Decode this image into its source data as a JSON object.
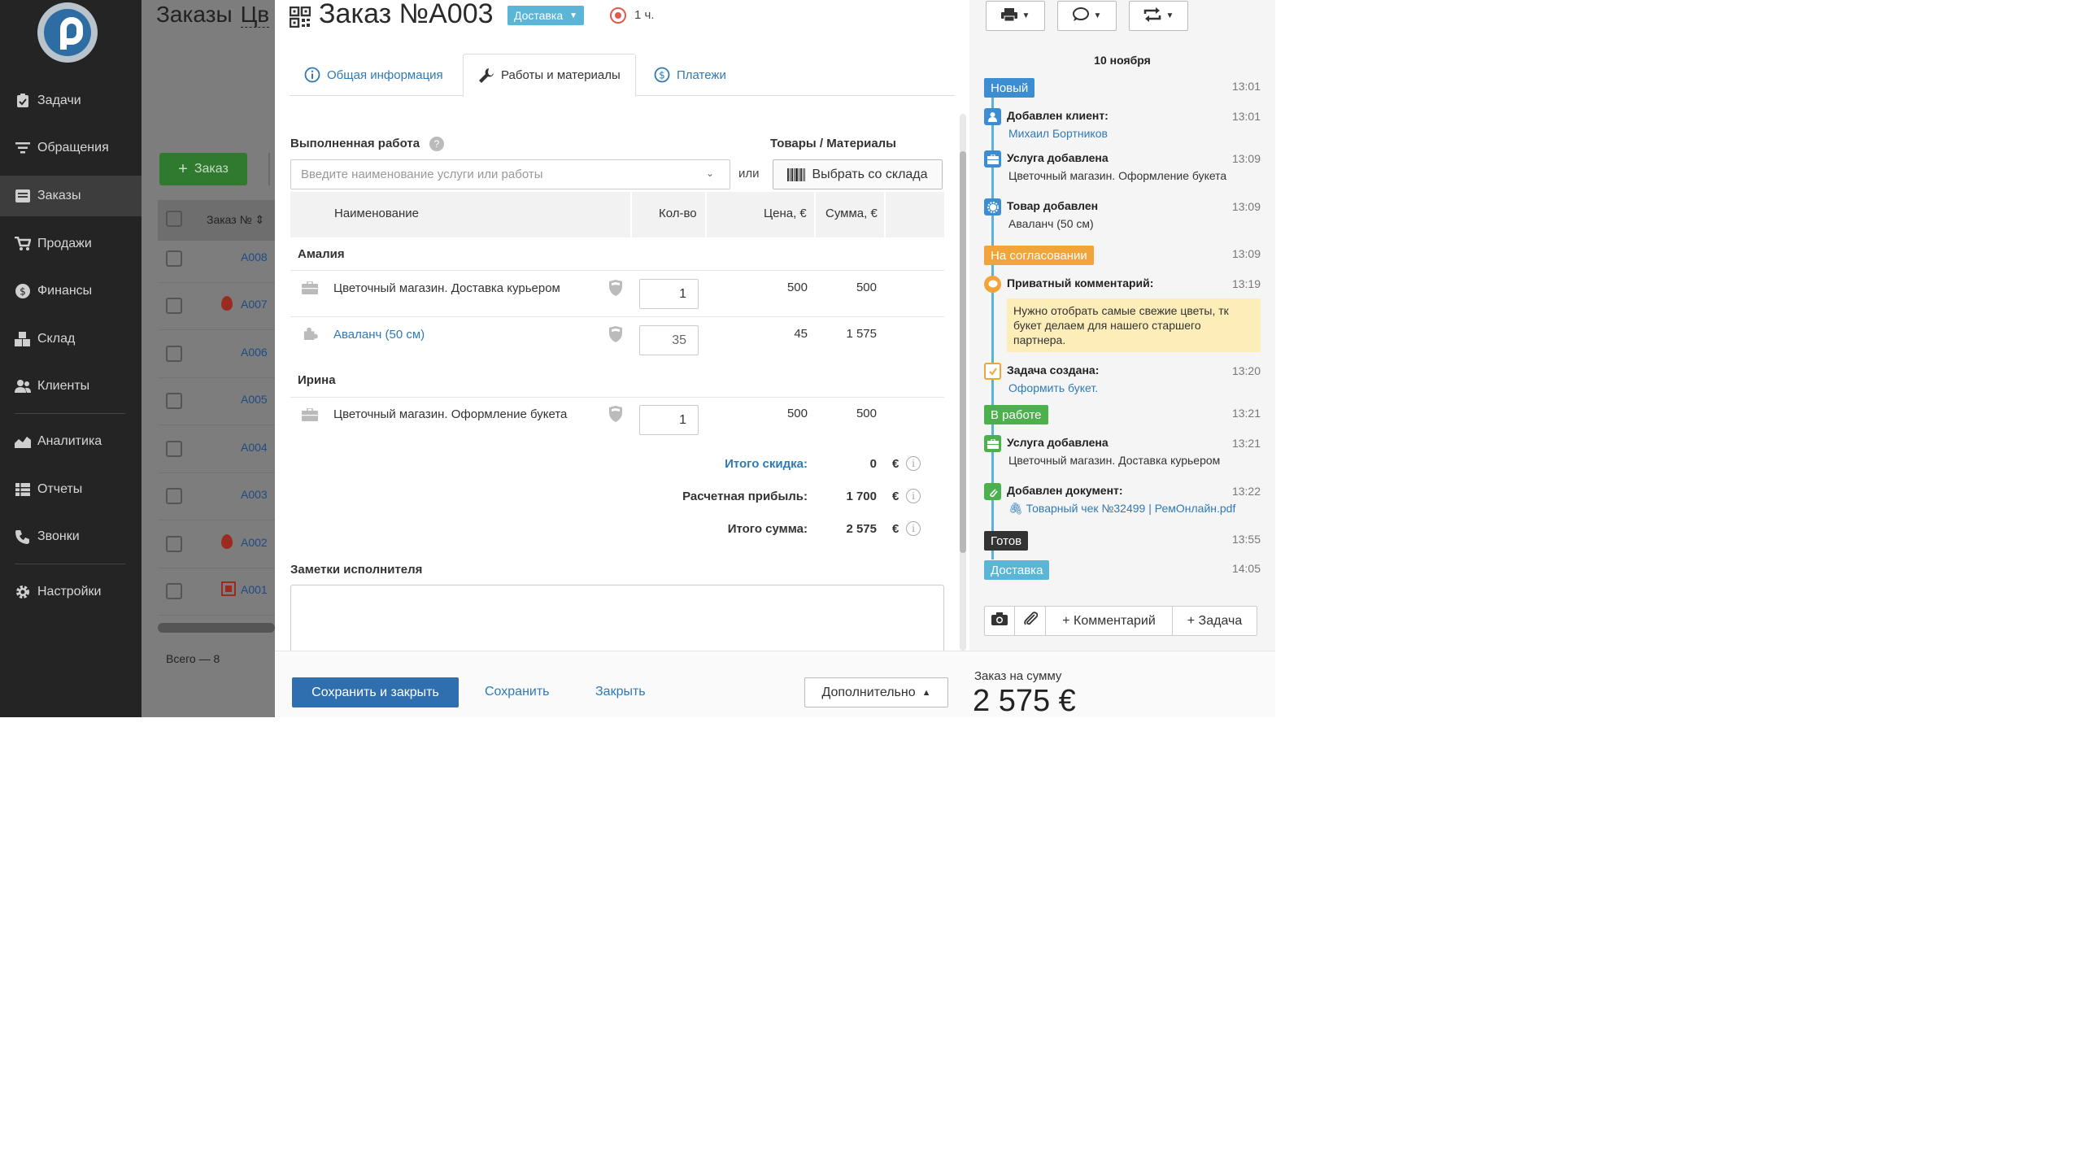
{
  "sidebar": {
    "items": [
      {
        "label": "Задачи",
        "icon": "clipboard-check-icon"
      },
      {
        "label": "Обращения",
        "icon": "filter-icon"
      },
      {
        "label": "Заказы",
        "icon": "order-list-icon"
      },
      {
        "label": "Продажи",
        "icon": "cart-icon"
      },
      {
        "label": "Финансы",
        "icon": "dollar-icon"
      },
      {
        "label": "Склад",
        "icon": "boxes-icon"
      },
      {
        "label": "Клиенты",
        "icon": "users-icon"
      },
      {
        "label": "Аналитика",
        "icon": "chart-area-icon"
      },
      {
        "label": "Отчеты",
        "icon": "table-icon"
      },
      {
        "label": "Звонки",
        "icon": "phone-icon"
      },
      {
        "label": "Настройки",
        "icon": "gear-icon"
      }
    ],
    "active": "Заказы"
  },
  "background_page": {
    "title": "Заказы",
    "title_suffix": "Цв",
    "add_button": "Заказ",
    "column_header": "Заказ №",
    "rows": [
      {
        "num": "A008",
        "marker": ""
      },
      {
        "num": "A007",
        "marker": "flame"
      },
      {
        "num": "A006",
        "marker": ""
      },
      {
        "num": "A005",
        "marker": ""
      },
      {
        "num": "A004",
        "marker": ""
      },
      {
        "num": "A003",
        "marker": ""
      },
      {
        "num": "A002",
        "marker": "flame"
      },
      {
        "num": "A001",
        "marker": "square"
      }
    ],
    "total": "Всего — 8"
  },
  "order": {
    "title": "Заказ №A003",
    "type_badge": "Доставка",
    "time": "1 ч.",
    "colors": {
      "accent": "#2f6fb0",
      "link": "#2f7ab5",
      "badge": "#5bb5d6",
      "urgent": "#e05a4e"
    }
  },
  "tabs": [
    {
      "label": "Общая информация",
      "icon": "info-icon"
    },
    {
      "label": "Работы и материалы",
      "icon": "wrench-icon"
    },
    {
      "label": "Платежи",
      "icon": "dollar-circle-icon"
    }
  ],
  "work": {
    "label": "Выполненная работа",
    "help": "?",
    "goods_label": "Товары / Материалы",
    "input_placeholder": "Введите наименование услуги или работы",
    "or": "или",
    "stock_button": "Выбрать со склада"
  },
  "table": {
    "headers": {
      "name": "Наименование",
      "qty": "Кол-во",
      "price": "Цена, €",
      "sum": "Сумма, €"
    },
    "groups": [
      {
        "title": "Амалия",
        "rows": [
          {
            "name": "Цветочный магазин. Доставка курьером",
            "qty": "1",
            "price": "500",
            "sum": "500",
            "link": false,
            "icon": "briefcase-icon"
          },
          {
            "name": "Аваланч (50 см)",
            "qty": "35",
            "price": "45",
            "sum": "1 575",
            "link": true,
            "icon": "puzzle-icon"
          }
        ]
      },
      {
        "title": "Ирина",
        "rows": [
          {
            "name": "Цветочный магазин. Оформление букета",
            "qty": "1",
            "price": "500",
            "sum": "500",
            "link": false,
            "icon": "briefcase-icon"
          }
        ]
      }
    ]
  },
  "totals": {
    "discount_label": "Итого скидка:",
    "discount_value": "0",
    "profit_label": "Расчетная прибыль:",
    "profit_value": "1 700",
    "total_label": "Итого сумма:",
    "total_value": "2 575",
    "currency": "€"
  },
  "notes": {
    "label": "Заметки исполнителя",
    "value": ""
  },
  "footer": {
    "save_close": "Сохранить и закрыть",
    "save": "Сохранить",
    "close": "Закрыть",
    "more": "Дополнительно",
    "order_sum_label": "Заказ на сумму",
    "order_sum_value": "2 575 €"
  },
  "timeline": {
    "date": "10 ноября",
    "events": {
      "status_new": {
        "label": "Новый",
        "time": "13:01"
      },
      "client_added": {
        "title": "Добавлен клиент:",
        "sub": "Михаил Бортников",
        "time": "13:01"
      },
      "service_added_1": {
        "title": "Услуга добавлена",
        "sub": "Цветочный магазин. Оформление букета",
        "time": "13:09"
      },
      "product_added": {
        "title": "Товар добавлен",
        "sub": "Аваланч (50 см)",
        "time": "13:09"
      },
      "status_approval": {
        "label": "На согласовании",
        "time": "13:09"
      },
      "private_comment": {
        "title": "Приватный комментарий:",
        "text": "Нужно отобрать самые свежие цветы, тк букет делаем для нашего старшего партнера.",
        "time": "13:19"
      },
      "task_created": {
        "title": "Задача создана:",
        "sub": "Оформить букет.",
        "time": "13:20"
      },
      "status_work": {
        "label": "В работе",
        "time": "13:21"
      },
      "service_added_2": {
        "title": "Услуга добавлена",
        "sub": "Цветочный магазин. Доставка курьером",
        "time": "13:21"
      },
      "doc_added": {
        "title": "Добавлен документ:",
        "sub": "Товарный чек №32499 | РемОнлайн.pdf",
        "time": "13:22"
      },
      "status_ready": {
        "label": "Готов",
        "time": "13:55"
      },
      "status_delivery": {
        "label": "Доставка",
        "time": "14:05"
      }
    },
    "status_colors": {
      "new": "#3c8dd1",
      "approval": "#f0a43a",
      "work": "#4cb04c",
      "ready": "#333333",
      "delivery": "#5bb5d6"
    },
    "actions": {
      "comment": "+ Комментарий",
      "task": "+ Задача"
    }
  }
}
